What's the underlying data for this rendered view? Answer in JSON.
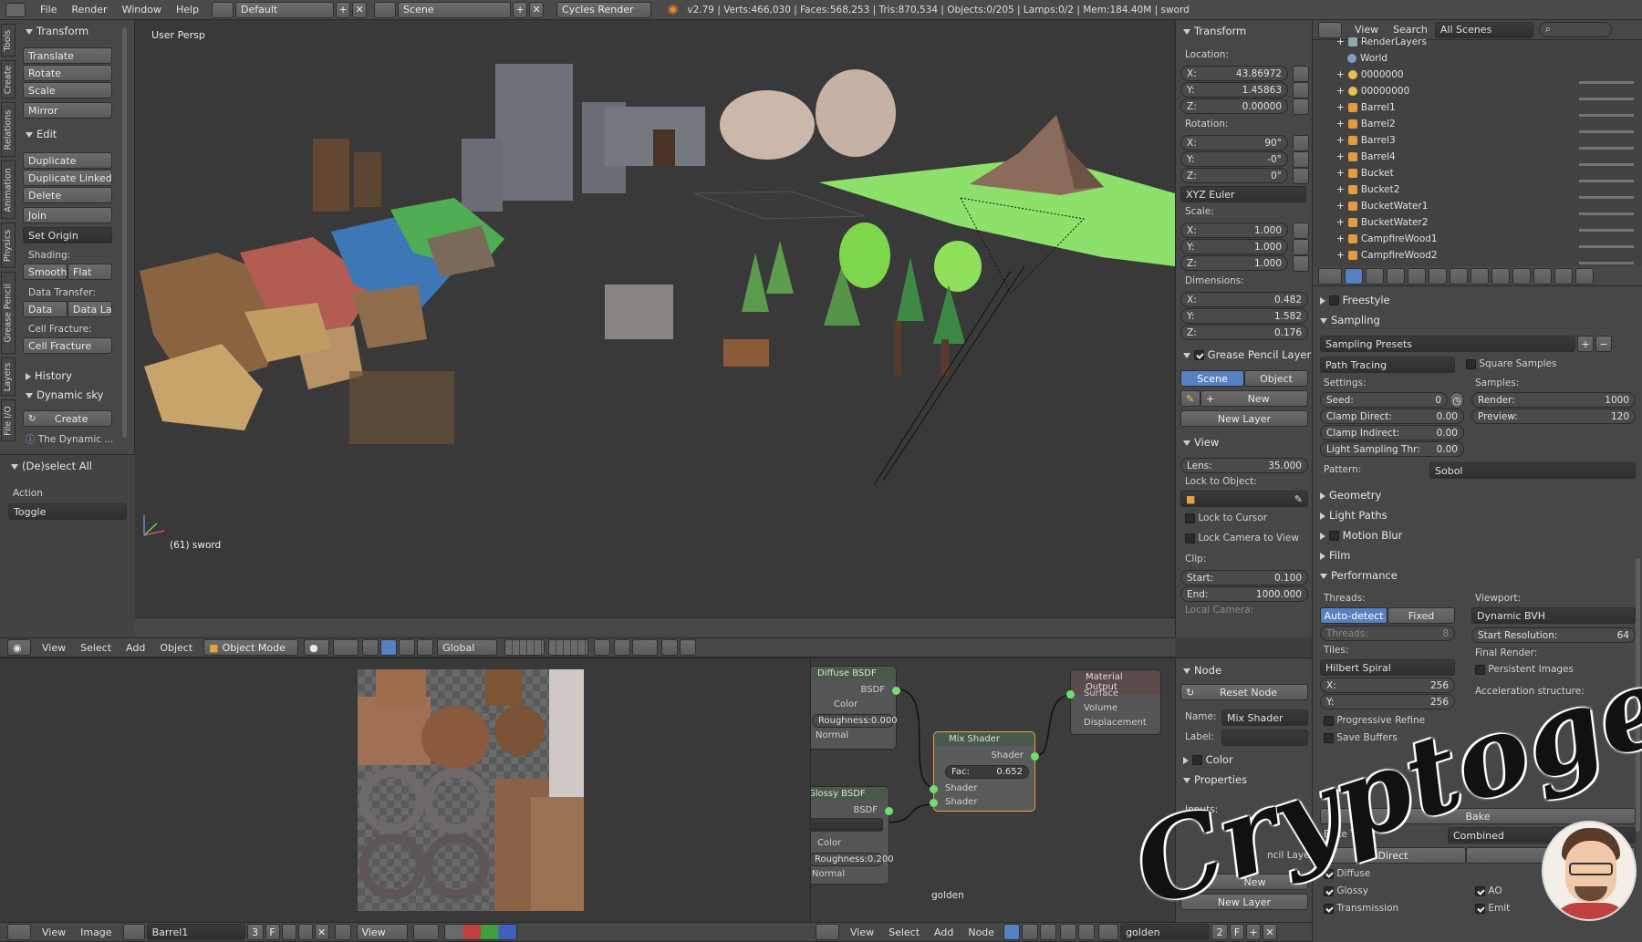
{
  "topbar": {
    "menus": [
      "File",
      "Render",
      "Window",
      "Help"
    ],
    "screen": "Default",
    "scene": "Scene",
    "engine": "Cycles Render",
    "stats": "v2.79 | Verts:466,030 | Faces:568,253 | Tris:870,534 | Objects:0/205 | Lamps:0/2 | Mem:184.40M | sword"
  },
  "tools_tabs": [
    "Tools",
    "Create",
    "Relations",
    "Animation",
    "Physics",
    "Grease Pencil",
    "Layers",
    "File I/O"
  ],
  "tools": {
    "transform_title": "Transform",
    "translate": "Translate",
    "rotate": "Rotate",
    "scale": "Scale",
    "mirror": "Mirror",
    "edit_title": "Edit",
    "duplicate": "Duplicate",
    "duplicate_linked": "Duplicate Linked",
    "delete": "Delete",
    "join": "Join",
    "set_origin": "Set Origin",
    "shading_label": "Shading:",
    "smooth": "Smooth",
    "flat": "Flat",
    "data_transfer_label": "Data Transfer:",
    "data": "Data",
    "data_la": "Data La",
    "cell_fracture_label": "Cell Fracture:",
    "cell_fracture": "Cell Fracture",
    "history_title": "History",
    "dynsky_title": "Dynamic sky",
    "create": "Create",
    "dynamic_info": "The Dynamic ...",
    "deselect_title": "(De)select All",
    "action_label": "Action",
    "action_value": "Toggle"
  },
  "viewport": {
    "label": "User Persp",
    "object_label": "(61) sword"
  },
  "viewport_header": {
    "menus": [
      "View",
      "Select",
      "Add",
      "Object"
    ],
    "mode": "Object Mode",
    "orientation": "Global"
  },
  "npanel": {
    "transform_title": "Transform",
    "location_label": "Location:",
    "loc_x": "X:",
    "loc_x_val": "43.86972",
    "loc_y": "Y:",
    "loc_y_val": "1.45863",
    "loc_z": "Z:",
    "loc_z_val": "0.00000",
    "rotation_label": "Rotation:",
    "rot_x_val": "90°",
    "rot_y_val": "-0°",
    "rot_z_val": "0°",
    "rot_mode": "XYZ Euler",
    "scale_label": "Scale:",
    "scl_x_val": "1.000",
    "scl_y_val": "1.000",
    "scl_z_val": "1.000",
    "dimensions_label": "Dimensions:",
    "dim_x_val": "0.482",
    "dim_y_val": "1.582",
    "dim_z_val": "0.176",
    "gp_title": "Grease Pencil Layer",
    "gp_scene": "Scene",
    "gp_object": "Object",
    "gp_new": "New",
    "gp_new_layer": "New Layer",
    "view_title": "View",
    "lens_label": "Lens:",
    "lens_val": "35.000",
    "lock_obj_label": "Lock to Object:",
    "lock_cursor": "Lock to Cursor",
    "lock_camera": "Lock Camera to View",
    "clip_label": "Clip:",
    "clip_start": "Start:",
    "clip_start_val": "0.100",
    "clip_end": "End:",
    "clip_end_val": "1000.000",
    "local_camera": "Local Camera:"
  },
  "outliner": {
    "header": {
      "view": "View",
      "search": "Search",
      "scenes": "All Scenes"
    },
    "items": [
      "RenderLayers",
      "World",
      "0000000",
      "00000000",
      "Barrel1",
      "Barrel2",
      "Barrel3",
      "Barrel4",
      "Bucket",
      "Bucket2",
      "BucketWater1",
      "BucketWater2",
      "CampfireWood1",
      "CampfireWood2"
    ]
  },
  "properties": {
    "freestyle": "Freestyle",
    "sampling": "Sampling",
    "sampling_presets": "Sampling Presets",
    "path_tracing": "Path Tracing",
    "square_samples": "Square Samples",
    "settings_label": "Settings:",
    "samples_label": "Samples:",
    "seed": "Seed:",
    "seed_val": "0",
    "render": "Render:",
    "render_val": "1000",
    "clamp_direct": "Clamp Direct:",
    "clamp_direct_val": "0.00",
    "preview": "Preview:",
    "preview_val": "120",
    "clamp_indirect": "Clamp Indirect:",
    "clamp_indirect_val": "0.00",
    "light_sampling": "Light Sampling Thr:",
    "light_sampling_val": "0.00",
    "pattern_label": "Pattern:",
    "pattern_val": "Sobol",
    "geometry": "Geometry",
    "light_paths": "Light Paths",
    "motion_blur": "Motion Blur",
    "film": "Film",
    "performance": "Performance",
    "threads_label": "Threads:",
    "viewport_label": "Viewport:",
    "auto_detect": "Auto-detect",
    "fixed": "Fixed",
    "dynamic_bvh": "Dynamic BVH",
    "threads_field": "Threads:",
    "threads_val": "8",
    "start_res": "Start Resolution:",
    "start_res_val": "64",
    "tiles_label": "Tiles:",
    "final_render": "Final Render:",
    "hilbert": "Hilbert Spiral",
    "persistent": "Persistent Images",
    "tile_x": "X:",
    "tile_x_val": "256",
    "tile_y": "Y:",
    "tile_y_val": "256",
    "accel": "Acceleration structure:",
    "progressive": "Progressive Refine",
    "save_buffers": "Save Buffers",
    "bake": "Bake",
    "bake_type_label": "Bake Type:",
    "bake_type": "Combined",
    "direct": "Direct",
    "diffuse": "Diffuse",
    "glossy": "Glossy",
    "transmission": "Transmission",
    "ao": "AO",
    "emit": "Emit"
  },
  "image_editor": {
    "menus": [
      "View",
      "Image"
    ],
    "image_name": "Barrel1",
    "users": "3",
    "f": "F"
  },
  "node_editor": {
    "diffuse_bsdf": "Diffuse BSDF",
    "bsdf": "BSDF",
    "color": "Color",
    "roughness": "Roughness:",
    "roughness_val": "0.000",
    "normal": "Normal",
    "glossy_bsdf": "Glossy BSDF",
    "glossy_rough": "Roughness:",
    "glossy_rough_val": "0.200",
    "glossy_normal": "Normal",
    "mix_shader": "Mix Shader",
    "shader": "Shader",
    "fac": "Fac:",
    "fac_val": "0.652",
    "shader_in1": "Shader",
    "shader_in2": "Shader",
    "material_output": "Material Output",
    "surface": "Surface",
    "volume": "Volume",
    "displacement": "Displacement",
    "material_name": "golden",
    "header": {
      "menus": [
        "View",
        "Select",
        "Add",
        "Node"
      ],
      "material": "golden",
      "users": "2",
      "f": "F"
    }
  },
  "node_side": {
    "node_title": "Node",
    "reset_node": "Reset Node",
    "name_label": "Name:",
    "name_val": "Mix Shader",
    "label_label": "Label:",
    "color_title": "Color",
    "props_title": "Properties",
    "inputs_label": "Inputs:",
    "new": "New",
    "new_layer": "New Layer",
    "pencil_layer": "ncil Layer"
  },
  "watermark": "Cryptogene",
  "colors": {
    "accent_blue": "#5680c2",
    "ground_green": "#8de06a",
    "bg": "#3d3d3d"
  }
}
